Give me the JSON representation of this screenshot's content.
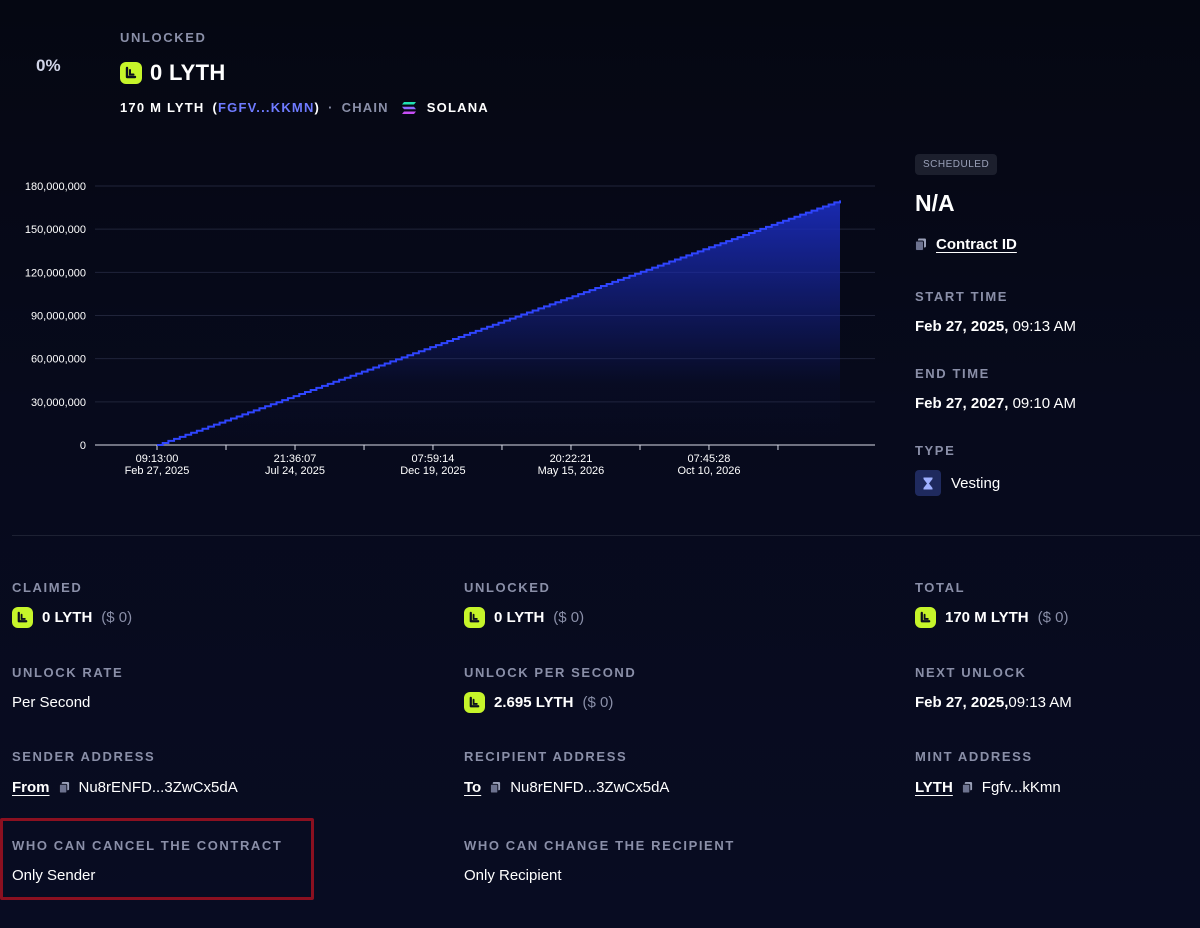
{
  "header": {
    "percent": "0%",
    "unlocked_label": "UNLOCKED",
    "unlocked_amount": "0 LYTH",
    "total_amount": "170 M LYTH",
    "mint_open": "(",
    "mint_short": "FGFV...KKMN",
    "mint_close": ")",
    "separator": "·",
    "chain_label": "CHAIN",
    "chain_name": "SOLANA"
  },
  "chart_data": {
    "type": "area",
    "title": "",
    "xlabel": "",
    "ylabel": "",
    "step": true,
    "ylim": [
      0,
      180000000
    ],
    "y_ticks": [
      "180,000,000",
      "150,000,000",
      "120,000,000",
      "90,000,000",
      "60,000,000",
      "30,000,000",
      "0"
    ],
    "y_tick_values": [
      180000000,
      150000000,
      120000000,
      90000000,
      60000000,
      30000000,
      0
    ],
    "x_ticks": [
      {
        "time": "09:13:00",
        "date": "Feb 27, 2025"
      },
      {
        "time": "21:36:07",
        "date": "Jul 24, 2025"
      },
      {
        "time": "07:59:14",
        "date": "Dec 19, 2025"
      },
      {
        "time": "20:22:21",
        "date": "May 15, 2026"
      },
      {
        "time": "07:45:28",
        "date": "Oct 10, 2026"
      }
    ],
    "x_tick_dates": [
      "2025-02-27T09:13:00",
      "2025-07-24T21:36:07",
      "2025-12-19T07:59:14",
      "2026-05-15T20:22:21",
      "2026-10-10T07:45:28"
    ],
    "xlim": [
      "2025-02-27T09:13:00",
      "2027-02-27T09:10:00"
    ],
    "series": [
      {
        "values": [
          {
            "x": "2025-02-27T09:13:00",
            "y": 0
          },
          {
            "x": "2027-02-27T09:10:00",
            "y": 170000000
          }
        ]
      }
    ],
    "colors": {
      "line": "#2f45ff",
      "fill_top": "#1a2bb8",
      "grid": "#20243a"
    },
    "grid": true
  },
  "side": {
    "badge": "SCHEDULED",
    "name": "N/A",
    "contract_link": "Contract ID",
    "start_label": "START TIME",
    "start_date": "Feb 27, 2025,",
    "start_time": " 09:13 AM",
    "end_label": "END TIME",
    "end_date": "Feb 27, 2027,",
    "end_time": " 09:10 AM",
    "type_label": "TYPE",
    "type_value": "Vesting"
  },
  "details": {
    "claimed": {
      "label": "CLAIMED",
      "amount": "0 LYTH",
      "usd": "($ 0)"
    },
    "unlocked": {
      "label": "UNLOCKED",
      "amount": "0 LYTH",
      "usd": "($ 0)"
    },
    "total": {
      "label": "TOTAL",
      "amount": "170 M LYTH",
      "usd": "($ 0)"
    },
    "unlock_rate": {
      "label": "UNLOCK RATE",
      "value": "Per Second"
    },
    "unlock_per_second": {
      "label": "UNLOCK PER SECOND",
      "amount": "2.695 LYTH",
      "usd": "($ 0)"
    },
    "next_unlock": {
      "label": "NEXT UNLOCK",
      "date": "Feb 27, 2025,",
      "time": " 09:13 AM"
    },
    "sender": {
      "label": "SENDER ADDRESS",
      "link": "From",
      "address": "Nu8rENFD...3ZwCx5dA"
    },
    "recipient": {
      "label": "RECIPIENT ADDRESS",
      "link": "To",
      "address": "Nu8rENFD...3ZwCx5dA"
    },
    "mint": {
      "label": "MINT ADDRESS",
      "link": "LYTH",
      "address": "Fgfv...kKmn"
    },
    "cancel": {
      "label": "WHO CAN CANCEL THE CONTRACT",
      "value": "Only Sender"
    },
    "change_recipient": {
      "label": "WHO CAN CHANGE THE RECIPIENT",
      "value": "Only Recipient"
    }
  },
  "icons": {
    "token": "lyth-token-icon",
    "copy": "copy-icon",
    "chain": "solana-icon",
    "type": "hourglass-icon"
  },
  "colors": {
    "accent_token": "#c6f52a",
    "link_purple": "#6f7bff",
    "highlight_border": "#8b1020",
    "label_gray": "#8a8fa8"
  }
}
